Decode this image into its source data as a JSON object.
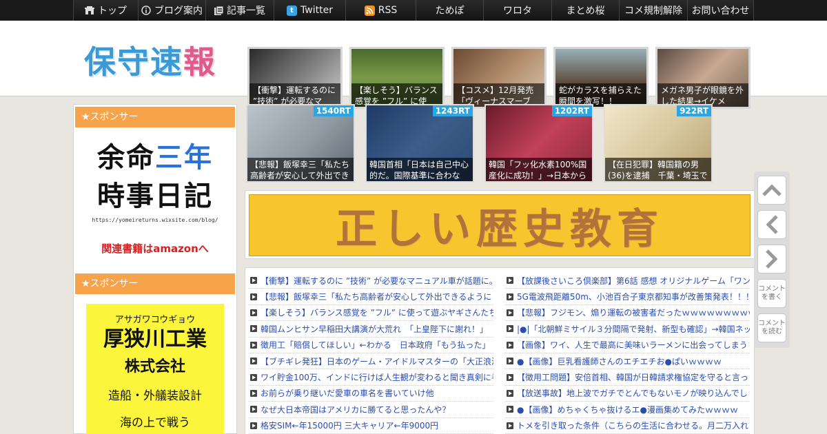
{
  "nav": {
    "items": [
      {
        "label": "トップ",
        "icon": "home-icon"
      },
      {
        "label": "ブログ案内",
        "icon": "info-icon"
      },
      {
        "label": "記事一覧",
        "icon": "list-icon"
      },
      {
        "label": "Twitter",
        "icon": "twitter-icon"
      },
      {
        "label": "RSS",
        "icon": "rss-icon"
      },
      {
        "label": "ためぽ",
        "icon": ""
      },
      {
        "label": "ワロタ",
        "icon": ""
      },
      {
        "label": "まとめ桜",
        "icon": ""
      },
      {
        "label": "コメ規制解除",
        "icon": ""
      },
      {
        "label": "お問い合わせ",
        "icon": ""
      }
    ]
  },
  "header": {
    "logo_part1": "保守速",
    "logo_part2": "報",
    "thumbs": [
      {
        "caption": "【衝撃】運転するのに ”技術” が必要なマ",
        "color": "#6b6b6b"
      },
      {
        "caption": "【楽しそう】バランス感覚を ”フル” に使",
        "color": "#5d7a3a"
      },
      {
        "caption": "【コスメ】12月発売「ヴィーナスマーブ",
        "color": "#8a6a52"
      },
      {
        "caption": "蛇がカラスを捕らえた瞬間を激写！！",
        "color": "#7a6a4a"
      },
      {
        "caption": "メガネ男子が眼鏡を外した結果→イケメ",
        "color": "#8a7a70"
      }
    ]
  },
  "sidebar": {
    "sponsor_label": "★スポンサー",
    "ad1": {
      "line1_a": "余命",
      "line1_b": "三年",
      "line2": "時事日記",
      "url": "https://yomeireturns.wixsite.com/blog/",
      "related": "関連書籍はamazonへ"
    },
    "sponsor_label_2": "★スポンサー",
    "ad2": {
      "kana": "アサガワコウギョウ",
      "name": "厚狭川工業",
      "corp": "株式会社",
      "biz": "造船・外艤装設計",
      "more": "海の上で戦う"
    }
  },
  "featured": [
    {
      "rt": "1540RT",
      "caption": "【悲報】飯塚幸三「私たち高齢者が安心して外出でき",
      "color": "#7f8a93"
    },
    {
      "rt": "1243RT",
      "caption": "韓国首相「日本は自己中心的だ。国際基準に合わな",
      "color": "#3d5d8a"
    },
    {
      "rt": "1202RT",
      "caption": "韓国「フッ化水素100%国産化に成功！」→日本から原",
      "color": "#b0344a"
    },
    {
      "rt": "922RT",
      "caption": "【在日犯罪】韓国籍の男(36)を逮捕　千葉・埼玉で",
      "color": "#d7c9a0"
    }
  ],
  "banner": {
    "text": "正しい歴史教育"
  },
  "list_left": [
    "【衝撃】運転するのに ”技術” が必要なマニュアル車が話題に。",
    "【悲報】飯塚幸三「私たち高齢者が安心して外出できるように",
    "【楽しそう】バランス感覚を ”フル” に使って遊ぶヤギさんたち",
    "韓国ムンヒサン早稲田大講演が大荒れ　「上皇陛下に謝れ！」",
    "徴用工「賠償してほしい」←わかる　日本政府「もう払った」",
    "【ブチギレ発狂】日本のゲーム・アイドルマスターの「大正浪漫",
    "ワイ貯金100万、インドに行けば人生観が変わると聞き真剣に考",
    "お前らが乗り継いだ愛車の車名を書いていけ他",
    "なぜ大日本帝国はアメリカに勝てると思ったんや？",
    "格安SIM←年15000円 三大キャリア←年9000円"
  ],
  "list_right": [
    "【放課後さいころ倶楽部】第6話 感想 オリジナルゲーム「ワン",
    "5G電波飛距離50m、小池百合子東京都知事が改善策発表！！！",
    "【悲報】フジモン、煽り運転の被害者だったｗｗｗｗｗｗｗｗｗ",
    "|●|「北朝鮮ミサイル３分間隔で発射、新型も確認」→韓国ネッ",
    "【画像】ワイ、人生で最高に美味いラーメンに出会ってしまう",
    "●【画像】巨乳看護師さんのエチエチお●ぱいｗｗｗｗ",
    "【徴用工問題】安倍首相、韓国が日韓請求権協定を守ると言っ",
    "【放送事故】地上波でガチでとんでもないモノが映り込んでし",
    "●【画像】めちゃくちゃ抜けるエ●漫画集めてみたｗｗｗｗ",
    "トメを引き取った条件（こちらの生活に合わせる。月二万入れ"
  ],
  "floatbar": {
    "write_comment": "コメントを書く",
    "read_comment": "コメントを読む"
  }
}
